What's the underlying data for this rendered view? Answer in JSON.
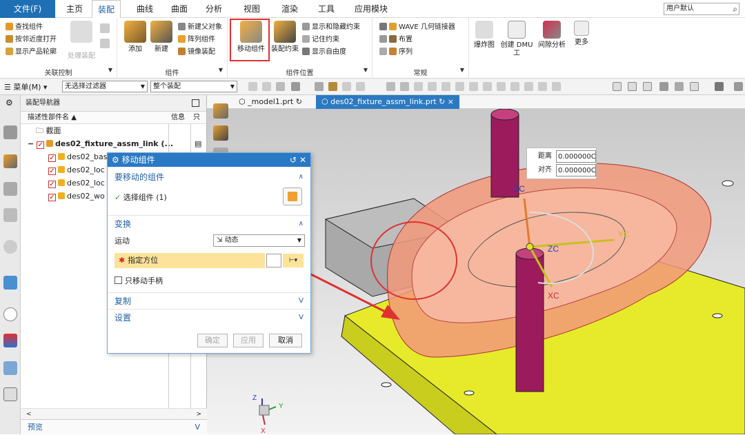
{
  "menu": {
    "file": "文件(F)",
    "tabs": [
      "主页",
      "装配",
      "曲线",
      "曲面",
      "分析",
      "视图",
      "渲染",
      "工具",
      "应用模块"
    ],
    "user_default": "用户默认"
  },
  "ribbon": {
    "groups": {
      "assoc_control": {
        "label": "关联控制",
        "items": [
          "查找组件",
          "按邻近度打开",
          "显示产品轮廓"
        ],
        "disabled_button": "处理装配"
      },
      "component": {
        "label": "组件",
        "buttons": [
          "添加",
          "新建"
        ],
        "items": [
          "新建父对象",
          "阵列组件",
          "镜像装配"
        ]
      },
      "component_position": {
        "label": "组件位置",
        "buttons": [
          "移动组件",
          "装配约束"
        ],
        "items": [
          "显示和隐藏约束",
          "记住约束",
          "显示自由度"
        ]
      },
      "general": {
        "label": "常规",
        "items": [
          "WAVE 几何链接器",
          "布置",
          "序列"
        ]
      },
      "extra": {
        "buttons": [
          "爆炸图",
          "创建 DMU 工",
          "间隙分析",
          "更多"
        ]
      }
    }
  },
  "toolbar2": {
    "menu": "菜单(M)",
    "filter": "无选择过滤器",
    "scope": "整个装配"
  },
  "navigator": {
    "title": "装配导航器",
    "columns": [
      "描述性部件名",
      "信息",
      "只"
    ],
    "tree": [
      {
        "label": "截面",
        "level": 1
      },
      {
        "label": "des02_fixture_assm_link (...",
        "level": 0
      },
      {
        "label": "des02_bas",
        "level": 2
      },
      {
        "label": "des02_loc",
        "level": 2
      },
      {
        "label": "des02_loc",
        "level": 2
      },
      {
        "label": "des02_wo",
        "level": 2
      }
    ],
    "preview": "预览"
  },
  "view_tabs": [
    {
      "label": "_model1.prt",
      "active": false
    },
    {
      "label": "des02_fixture_assm_link.prt",
      "active": true
    }
  ],
  "dialog": {
    "title": "移动组件",
    "section1": "要移动的组件",
    "select_component": "选择组件 (1)",
    "section2": "变换",
    "motion_label": "运动",
    "motion_value": "动态",
    "specify_orientation": "指定方位",
    "move_handle_only": "只移动手柄",
    "copy": "复制",
    "settings": "设置",
    "buttons": [
      "确定",
      "应用",
      "取消"
    ]
  },
  "measure": {
    "distance_label": "距离",
    "distance_value": "0.000000C",
    "align_label": "对齐",
    "align_value": "0.000000C"
  },
  "axes": {
    "zc": "ZC",
    "yc": "YC",
    "xc": "XC",
    "z": "Z",
    "y": "Y",
    "x": "X"
  },
  "colors": {
    "file_tab": "#1f6fb4",
    "dialog_title": "#2a79c5",
    "highlight_red": "#e03030",
    "base_plate": "#e6ea2a",
    "pin": "#9c1b5c",
    "mold_shell": "#f2997a"
  }
}
